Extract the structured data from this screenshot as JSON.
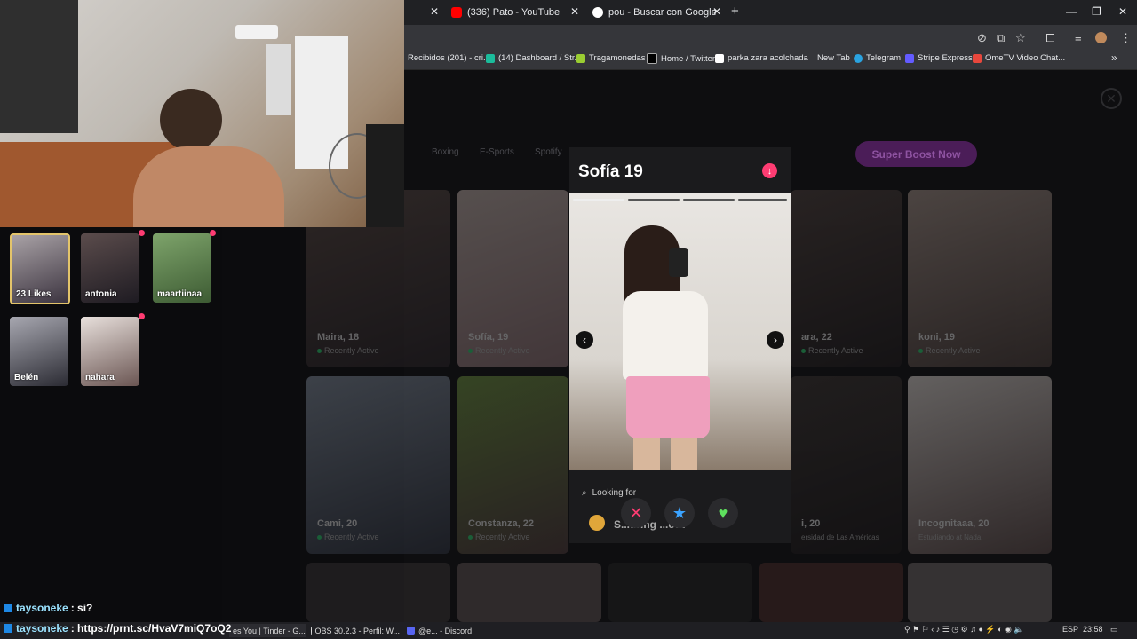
{
  "browser": {
    "tabs": [
      {
        "label": "(336) Pato - YouTube"
      },
      {
        "label": "pou - Buscar con Google"
      }
    ],
    "new_tab_symbol": "+",
    "bookmarks": [
      {
        "label": "Recibidos (201) - cri..."
      },
      {
        "label": "(14) Dashboard / Str..."
      },
      {
        "label": "Tragamonedas"
      },
      {
        "label": "Home / Twitter"
      },
      {
        "label": "parka zara acolchada"
      },
      {
        "label": "New Tab"
      },
      {
        "label": "Telegram"
      },
      {
        "label": "Stripe Express"
      },
      {
        "label": "OmeTV Video Chat..."
      }
    ],
    "overflow_symbol": "»"
  },
  "tinder": {
    "filter_chips": [
      "Boxing",
      "E-Sports",
      "Spotify"
    ],
    "super_boost_label": "Super Boost Now",
    "cards": [
      {
        "name": "Maira, 18",
        "status": "Recently Active"
      },
      {
        "name": "Sofía, 19",
        "status": "Recently Active"
      },
      {
        "name": "ara, 22",
        "status": "Recently Active"
      },
      {
        "name": "koni, 19",
        "status": "Recently Active"
      },
      {
        "name": "Cami, 20",
        "status": "Recently Active"
      },
      {
        "name": "Constanza, 22",
        "status": "Recently Active"
      },
      {
        "name": "i, 20",
        "status": "ersidad de Las Américas"
      },
      {
        "name": "Incognitaaa, 20",
        "status": "Estudiando at Nada"
      }
    ],
    "modal": {
      "name": "Sofía 19",
      "looking_for_label": "Looking for",
      "looking_for_value": "S...uring ...out"
    }
  },
  "likes_overlay": {
    "items": [
      {
        "label": "23 Likes"
      },
      {
        "label": "antonia"
      },
      {
        "label": "maartiinaa"
      },
      {
        "label": "Belén"
      },
      {
        "label": "nahara"
      }
    ]
  },
  "chat": [
    {
      "user": "taysoneke",
      "message": ": si?"
    },
    {
      "user": "taysoneke",
      "message": ": https://prnt.sc/HvaV7miQ7oQ2"
    }
  ],
  "taskbar": {
    "tasks": [
      {
        "label": "es You | Tinder - G..."
      },
      {
        "label": "OBS 30.2.3 - Perfil: W..."
      },
      {
        "label": "@e... - Discord"
      }
    ],
    "language": "ESP",
    "time": "23:58"
  },
  "colors": {
    "tinder_pink": "#fe3c72",
    "boost_purple": "#4b1d58",
    "verified_blue": "#3b8fe0"
  }
}
